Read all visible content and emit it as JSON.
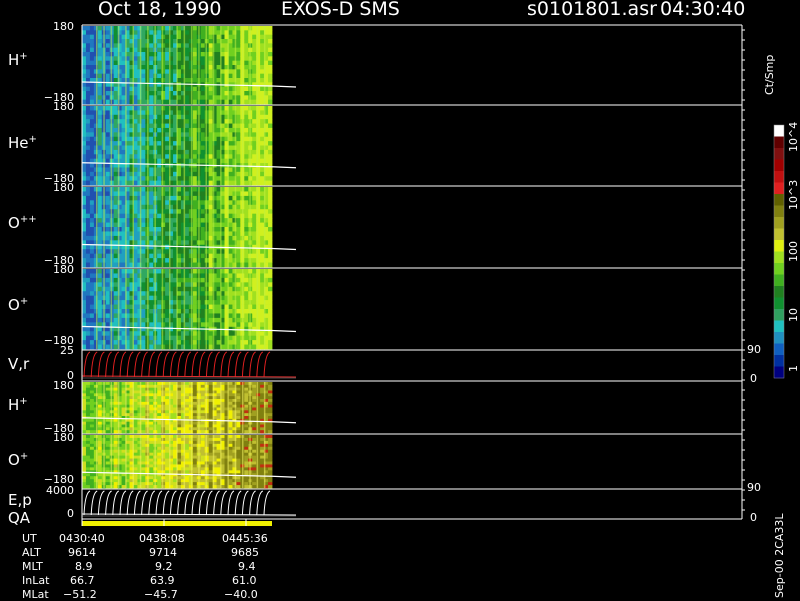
{
  "header": {
    "date": "Oct 18, 1990",
    "mission": "EXOS-D SMS",
    "file": "s0101801.asr",
    "time": "04:30:40"
  },
  "panels": [
    {
      "label": "H",
      "sup": "+",
      "ytop": "180",
      "ybot": "−180",
      "kind": "spectrogram",
      "palette": "cool"
    },
    {
      "label": "He",
      "sup": "+",
      "ytop": "180",
      "ybot": "−180",
      "kind": "spectrogram",
      "palette": "cool"
    },
    {
      "label": "O",
      "sup": "++",
      "ytop": "180",
      "ybot": "−180",
      "kind": "spectrogram",
      "palette": "cool"
    },
    {
      "label": "O",
      "sup": "+",
      "ytop": "180",
      "ybot": "−180",
      "kind": "spectrogram",
      "palette": "cool"
    },
    {
      "label": "V,r",
      "sup": "",
      "ytop": "25",
      "ybot": "0",
      "rtop": "90",
      "rbot": "0",
      "kind": "line"
    },
    {
      "label": "H",
      "sup": "+",
      "ytop": "180",
      "ybot": "−180",
      "kind": "spectrogram",
      "palette": "warm"
    },
    {
      "label": "O",
      "sup": "+",
      "ytop": "180",
      "ybot": "−180",
      "kind": "spectrogram",
      "palette": "warm"
    },
    {
      "label": "E,p",
      "sup": "",
      "ytop": "4000",
      "ybot": "0",
      "rtop": "90",
      "rbot": "0",
      "kind": "line"
    }
  ],
  "qa_label": "QA",
  "colorbar": {
    "unit": "Ct/Smp",
    "ticks": [
      "1",
      "10",
      "100",
      "10^3",
      "10^4"
    ],
    "colors": [
      "#000080",
      "#0030a0",
      "#1060c0",
      "#2090c0",
      "#20c0c0",
      "#30a060",
      "#109030",
      "#208020",
      "#40b020",
      "#70d020",
      "#a0e020",
      "#e0f010",
      "#c0c030",
      "#a0a020",
      "#808010",
      "#606000",
      "#e02020",
      "#c01010",
      "#a00000",
      "#801010",
      "#600000",
      "#ffffff"
    ]
  },
  "footer": {
    "row_labels": [
      "UT",
      "ALT",
      "MLT",
      "InLat",
      "MLat"
    ],
    "columns": [
      [
        "0430:40",
        "9614",
        "8.9",
        "66.7",
        "−51.2"
      ],
      [
        "0438:08",
        "9714",
        "9.2",
        "63.9",
        "−45.7"
      ],
      [
        "0445:36",
        "9685",
        "9.4",
        "61.0",
        "−40.0"
      ]
    ],
    "stamp": "Sep-00 2CA33L"
  },
  "chart_data": {
    "type": "heatmap",
    "title": "Oct 18, 1990 EXOS-D SMS",
    "x_ticks": [
      "0430:40",
      "0438:08",
      "0445:36"
    ],
    "series": [
      {
        "name": "H+",
        "ylim": [
          -180,
          180
        ]
      },
      {
        "name": "He+",
        "ylim": [
          -180,
          180
        ]
      },
      {
        "name": "O++",
        "ylim": [
          -180,
          180
        ]
      },
      {
        "name": "O+",
        "ylim": [
          -180,
          180
        ]
      },
      {
        "name": "V,r",
        "ylim": [
          0,
          25
        ],
        "right_ylim": [
          0,
          90
        ]
      },
      {
        "name": "H+",
        "ylim": [
          -180,
          180
        ]
      },
      {
        "name": "O+",
        "ylim": [
          -180,
          180
        ]
      },
      {
        "name": "E,p",
        "ylim": [
          0,
          4000
        ],
        "right_ylim": [
          0,
          90
        ]
      }
    ],
    "colorbar_label": "Ct/Smp",
    "colorbar_ticks": [
      "1",
      "10",
      "100",
      "10^3",
      "10^4"
    ]
  }
}
